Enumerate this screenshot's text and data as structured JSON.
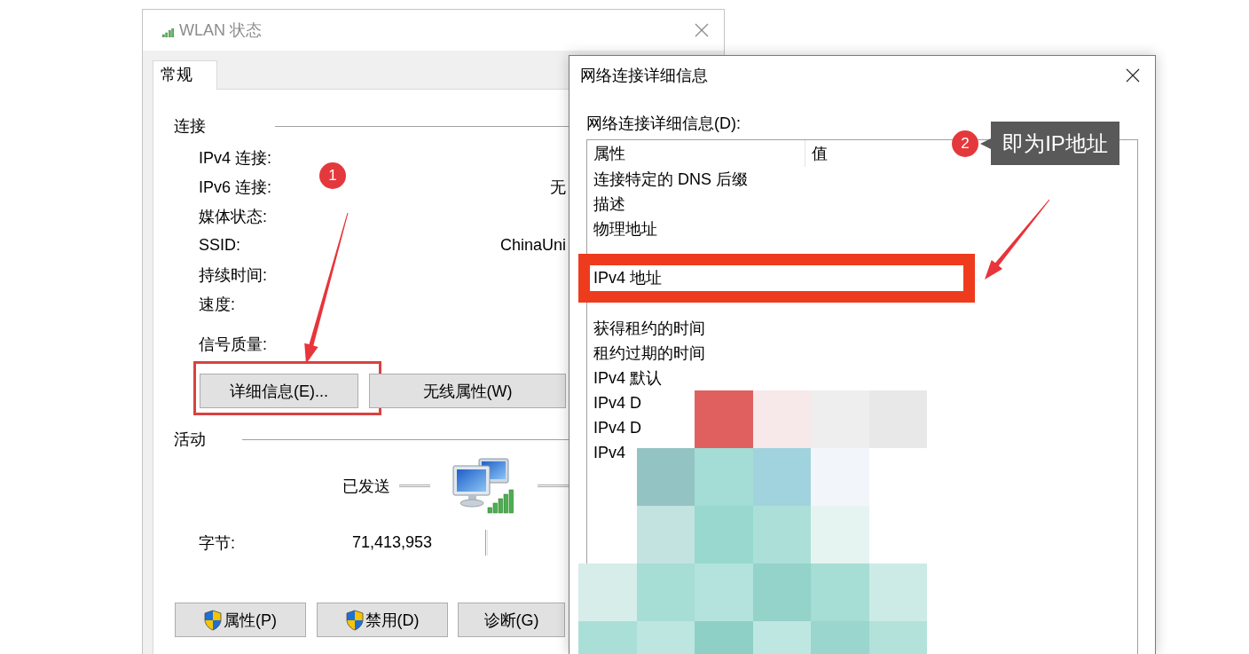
{
  "wlan_window": {
    "title": "WLAN 状态",
    "tabs": [
      {
        "label": "常规",
        "selected": true
      }
    ],
    "connection": {
      "heading": "连接",
      "rows": [
        {
          "label": "IPv4 连接:"
        },
        {
          "label": "IPv6 连接:",
          "value": "无"
        },
        {
          "label": "媒体状态:"
        },
        {
          "label": "SSID:",
          "value": "ChinaUni"
        },
        {
          "label": "持续时间:"
        },
        {
          "label": "速度:"
        }
      ],
      "signal_label": "信号质量:",
      "buttons": [
        {
          "label": "详细信息(E)...",
          "highlighted": true
        },
        {
          "label": "无线属性(W)",
          "highlighted": false
        }
      ]
    },
    "activity": {
      "heading": "活动",
      "sent_label": "已发送",
      "bytes_label": "字节:",
      "bytes_sent": "71,413,953"
    },
    "buttons": [
      {
        "label": "属性(P)",
        "shield": true
      },
      {
        "label": "禁用(D)",
        "shield": true
      },
      {
        "label": "诊断(G)",
        "shield": false
      }
    ]
  },
  "details_dialog": {
    "title": "网络连接详细信息",
    "list_label": "网络连接详细信息(D):",
    "columns": [
      "属性",
      "值"
    ],
    "rows": [
      {
        "property": "连接特定的 DNS 后缀",
        "highlighted": false
      },
      {
        "property": "描述",
        "highlighted": false
      },
      {
        "property": "物理地址",
        "highlighted": false
      },
      {
        "property": "IPv4 地址",
        "highlighted": true
      },
      {
        "property": "获得租约的时间",
        "highlighted": false
      },
      {
        "property": "租约过期的时间",
        "highlighted": false
      },
      {
        "property": "IPv4 默认",
        "highlighted": false
      },
      {
        "property": "IPv4 D",
        "highlighted": false
      },
      {
        "property": "IPv4 D",
        "highlighted": false
      },
      {
        "property": "IPv4",
        "highlighted": false
      }
    ],
    "redaction": {
      "kind": "mosaic"
    }
  },
  "annotations": {
    "badges": [
      "1",
      "2"
    ],
    "callout": "即为IP地址"
  }
}
